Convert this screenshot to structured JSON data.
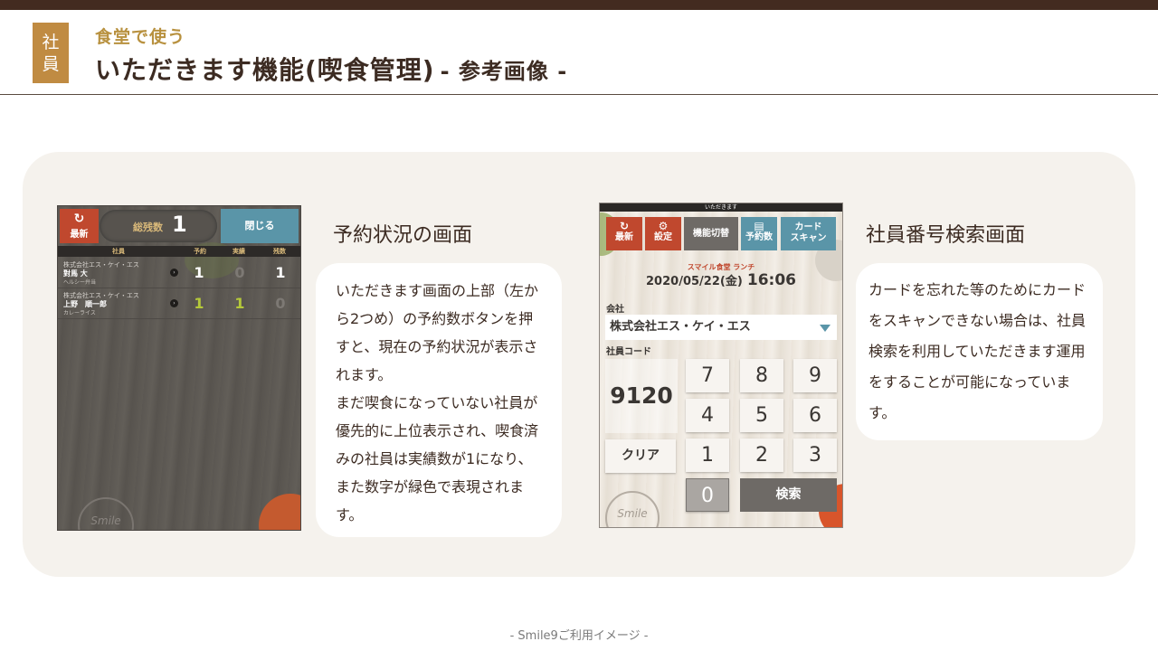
{
  "header": {
    "badge_line1": "社",
    "badge_line2": "員",
    "subtitle": "食堂で使う",
    "title": "いただきます機能(喫食管理)",
    "title_suffix": "- 参考画像 -"
  },
  "shot1": {
    "refresh_label": "最新",
    "total_label": "総残数",
    "total_value": "1",
    "close_label": "閉じる",
    "columns": [
      "社員",
      "予約",
      "実績",
      "残数"
    ],
    "rows": [
      {
        "company": "株式会社エス・ケイ・エス",
        "name": "對馬 大",
        "menu": "ヘルシー弁当",
        "reserved": "1",
        "actual": "0",
        "remaining": "1",
        "eaten": false
      },
      {
        "company": "株式会社エス・ケイ・エス",
        "name": "上野　順一郎",
        "menu": "カレーライス",
        "reserved": "1",
        "actual": "1",
        "remaining": "0",
        "eaten": true
      }
    ],
    "logo_text": "Smile"
  },
  "shot2": {
    "top_title": "いただきます",
    "buttons": [
      {
        "label": "最新",
        "icon": "refresh-icon"
      },
      {
        "label": "設定",
        "icon": "gear-icon"
      },
      {
        "label": "機能切替",
        "icon": ""
      },
      {
        "label": "予約数",
        "icon": "list-icon"
      },
      {
        "label_line1": "カード",
        "label_line2": "スキャン"
      }
    ],
    "shop": "スマイル食堂 ランチ",
    "date": "2020/05/22(金)",
    "time": "16:06",
    "company_label": "会社",
    "company_value": "株式会社エス・ケイ・エス",
    "code_label": "社員コード",
    "code_value": "9120",
    "keys": [
      "7",
      "8",
      "9",
      "4",
      "5",
      "6",
      "1",
      "2",
      "3",
      "0"
    ],
    "clear_label": "クリア",
    "search_label": "検索",
    "logo_text": "Smile"
  },
  "section1": {
    "title": "予約状況の画面",
    "paragraphs": [
      "いただきます画面の上部（左から2つめ）の予約数ボタンを押すと、現在の予約状況が表示されます。",
      "まだ喫食になっていない社員が優先的に上位表示され、喫食済みの社員は実績数が1になり、また数字が緑色で表現されます。"
    ]
  },
  "section2": {
    "title": "社員番号検索画面",
    "paragraphs": [
      "カードを忘れた等のためにカードをスキャンできない場合は、社員検索を利用していただきます運用をすることが可能になっています。"
    ]
  },
  "colors": {
    "brand_dark": "#432b20",
    "accent_gold": "#c08b42",
    "panel_bg": "#f5f2ed",
    "button_red": "#c0482e",
    "button_blue": "#5a95a8",
    "eaten_green": "#b5c93a"
  },
  "footer": "- Smile9ご利用イメージ -"
}
